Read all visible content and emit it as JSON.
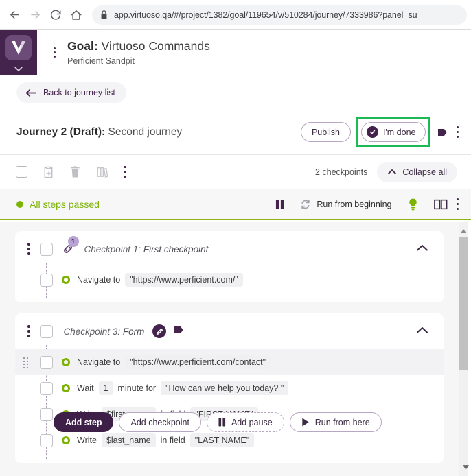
{
  "browser": {
    "back_icon": "arrow-left-icon",
    "forward_icon": "arrow-right-icon",
    "reload_icon": "reload-icon",
    "home_icon": "home-icon",
    "lock_icon": "lock-icon",
    "url": "app.virtuoso.qa/#/project/1382/goal/119654/v/510284/journey/7333986?panel=su"
  },
  "rail": {
    "logo_letter": "V",
    "chevron_icon": "chevron-down-icon"
  },
  "goal": {
    "kebab_icon": "vertical-dots-icon",
    "label": "Goal:",
    "name": "Virtuoso Commands",
    "project": "Perficient Sandpit"
  },
  "back": {
    "arrow_icon": "arrow-left-icon",
    "label": "Back to journey list"
  },
  "journey": {
    "name": "Journey 2 (Draft):",
    "subtitle": "Second journey",
    "publish_label": "Publish",
    "done_label": "I'm done",
    "done_check_icon": "check-circle-icon",
    "tag_icon": "tag-icon",
    "kebab_icon": "vertical-dots-icon",
    "highlight_color": "#1db954"
  },
  "select_toolbar": {
    "checkbox_icon": "checkbox-icon",
    "copy_icon": "clipboard-export-icon",
    "delete_icon": "trash-icon",
    "library_icon": "library-icon",
    "kebab_icon": "vertical-dots-icon",
    "checkpoints_count": "2 checkpoints",
    "collapse_label": "Collapse all",
    "collapse_icon": "chevron-up-icon"
  },
  "status": {
    "dot_color": "#7cb305",
    "text": "All steps passed",
    "pause_icon": "pause-icon",
    "refresh_icon": "refresh-icon",
    "run_label": "Run from beginning",
    "bulb_icon": "lightbulb-icon",
    "panel_icon": "split-panel-icon",
    "kebab_icon": "vertical-dots-icon",
    "accent_line_color": "#8cb713"
  },
  "checkpoints": [
    {
      "kebab_icon": "vertical-dots-icon",
      "checkbox_icon": "checkbox-icon",
      "link_icon": "link-icon",
      "link_badge": "1",
      "label": "Checkpoint 1:",
      "name": "First checkpoint",
      "chevron_icon": "chevron-up-icon",
      "steps": [
        {
          "checkbox_icon": "checkbox-icon",
          "status_icon": "pass-ring-icon",
          "action": "Navigate to",
          "chips": [
            "\"https://www.perficient.com/\""
          ],
          "highlighted": false,
          "grip": false
        }
      ]
    },
    {
      "kebab_icon": "vertical-dots-icon",
      "checkbox_icon": "checkbox-icon",
      "pencil_icon": "edit-pencil-icon",
      "tag_icon": "tag-icon",
      "label": "Checkpoint 3:",
      "name": "Form",
      "chevron_icon": "chevron-up-icon",
      "steps": [
        {
          "checkbox_icon": "checkbox-icon",
          "status_icon": "pass-ring-icon",
          "action": "Navigate to",
          "chips": [
            "\"https://www.perficient.com/contact\""
          ],
          "highlighted": true,
          "grip": true
        },
        {
          "checkbox_icon": "checkbox-icon",
          "status_icon": "pass-ring-icon",
          "action": "Wait",
          "chips": [
            "1"
          ],
          "mid": "minute for",
          "chips2": [
            "\"How can we help you today? \""
          ],
          "highlighted": false,
          "grip": false
        },
        {
          "checkbox_icon": "checkbox-icon",
          "status_icon": "pass-ring-icon",
          "action": "Write",
          "chips": [
            "$first_name"
          ],
          "mid": "in field",
          "chips2": [
            "\"FIRST NAME\""
          ],
          "highlighted": false,
          "grip": false
        },
        {
          "checkbox_icon": "checkbox-icon",
          "status_icon": "pass-ring-icon",
          "action": "Write",
          "chips": [
            "$last_name"
          ],
          "mid": "in field",
          "chips2": [
            "\"LAST NAME\""
          ],
          "highlighted": false,
          "grip": false
        }
      ]
    }
  ],
  "action_bar": {
    "add_step": "Add step",
    "add_checkpoint": "Add checkpoint",
    "add_pause": "Add pause",
    "add_pause_icon": "pause-icon",
    "run_from_here": "Run from here",
    "run_icon": "play-icon"
  },
  "scrollbar": {
    "up_arrow_icon": "scroll-up-arrow-icon",
    "down_arrow_icon": "scroll-down-arrow-icon"
  }
}
